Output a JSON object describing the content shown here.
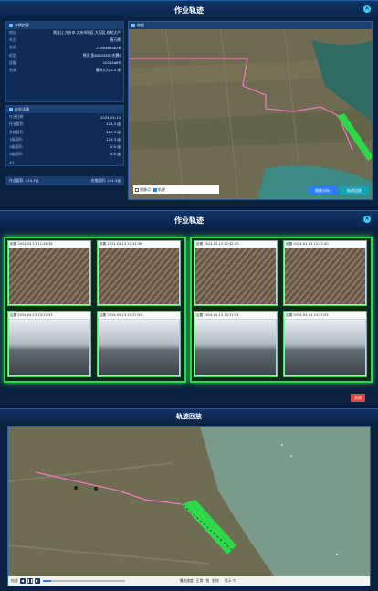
{
  "panel1": {
    "title": "作业轨迹",
    "vehicle_info": {
      "header": "车辆信息",
      "rows": [
        {
          "key": "地址:",
          "value": "黑龙江-大庆市-大庆市辖区-大同区-农机大户"
        },
        {
          "key": "车主:",
          "value": "袁万辉"
        },
        {
          "key": "电话:",
          "value": "13604669828"
        },
        {
          "key": "机型:",
          "value": "悍沃 凯6000395 (东腾)"
        },
        {
          "key": "设备:",
          "value": "10215a85"
        },
        {
          "key": "农具:",
          "value": "播种大为 1.3 米"
        }
      ]
    },
    "work_detail": {
      "header": "作业详情",
      "rows": [
        {
          "key": "作业日期:",
          "value": "2024-04-13"
        },
        {
          "key": "作业面积:",
          "value": "124.3 亩"
        },
        {
          "key": "合格面积:",
          "value": "124.3 亩"
        },
        {
          "key": "1级面积:",
          "value": "124.3 亩"
        },
        {
          "key": "2级面积:",
          "value": "0.0 亩"
        },
        {
          "key": "3级面积:",
          "value": "0.0 亩"
        }
      ],
      "index_label": "#1"
    },
    "summary": {
      "left": "作业面积: 124.3亩",
      "right": "合格面积: 124.3亩"
    },
    "map_header": "地图",
    "checkbox_labels": {
      "a": "图像点",
      "b": "轨迹"
    },
    "buttons": {
      "analysis": "图像分析",
      "playback": "轨迹回放"
    }
  },
  "panel2": {
    "title": "作业轨迹",
    "photos": [
      {
        "caption": "前置 2024-04-13 12:42:36"
      },
      {
        "caption": "前置 2024-04-13 12:42:36"
      },
      {
        "caption": "前置 2024-04-13 12:42:25"
      },
      {
        "caption": "前置 2024-04-13 12:42:40"
      },
      {
        "caption": "后置 2024-04-13 10:27:53"
      },
      {
        "caption": "后置 2024-04-13 10:27:53"
      },
      {
        "caption": "后置 2024-04-13 10:27:53"
      },
      {
        "caption": "后置 2024-04-13 10:27:53"
      }
    ],
    "background_button": "关闭"
  },
  "panel3": {
    "title": "轨迹回放",
    "player": {
      "speed_label": "播放速度",
      "options": [
        "正常",
        "快",
        "很快"
      ],
      "time_label": "显示 ℃",
      "label_left": "倍速"
    }
  },
  "colors": {
    "accent": "#2fd84a",
    "track_pink": "#f07ac0",
    "panel_bg": "#0b2142",
    "header_bg": "#1a3f73"
  }
}
